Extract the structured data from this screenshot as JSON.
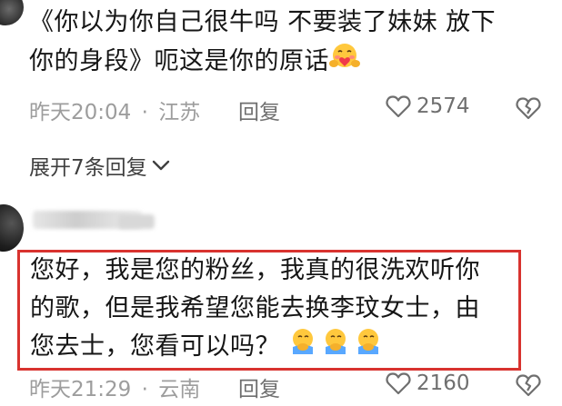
{
  "comment1": {
    "lines": [
      "《你以为你自己很牛吗 不要装了妹妹 放下",
      "你的身段》呃这是你的原话"
    ],
    "time": "昨天20:04",
    "separator": "·",
    "location": "江苏",
    "reply_label": "回复",
    "like_count": "2574",
    "emoji": "hugging-face-emoji"
  },
  "expand_replies": {
    "label": "展开7条回复",
    "icon": "chevron-down-icon"
  },
  "comment2": {
    "lines": [
      "您好，我是您的粉丝，我真的很洗欢听你",
      "的歌，但是我希望您能去换李玟女士，由",
      "您去士，您看可以吗？"
    ],
    "time": "昨天21:29",
    "separator": "·",
    "location": "云南",
    "reply_label": "回复",
    "like_count": "2160",
    "emoji": "hugging-emoji",
    "highlight_color": "#d8332f"
  },
  "icons": {
    "like": "heart-icon",
    "dislike": "broken-heart-icon"
  }
}
